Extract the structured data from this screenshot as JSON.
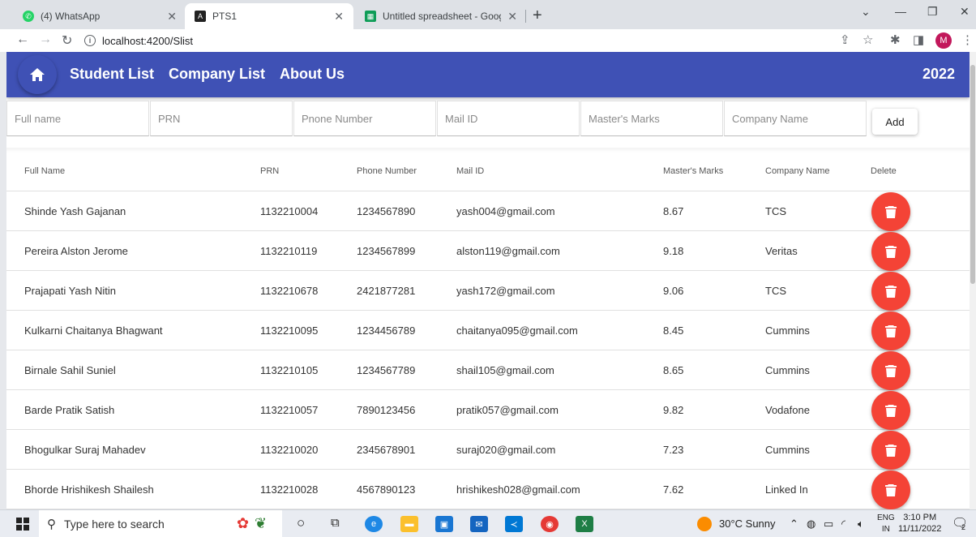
{
  "browser": {
    "tabs": [
      {
        "title": "(4) WhatsApp",
        "active": false
      },
      {
        "title": "PTS1",
        "active": true
      },
      {
        "title": "Untitled spreadsheet - Google Sh",
        "active": false
      }
    ],
    "url": "localhost:4200/Slist",
    "profile_initial": "M"
  },
  "app": {
    "nav": {
      "student_list": "Student List",
      "company_list": "Company List",
      "about_us": "About Us",
      "year": "2022"
    },
    "form": {
      "full_name_placeholder": "Full name",
      "prn_placeholder": "PRN",
      "phone_placeholder": "Pnone Number",
      "mail_placeholder": "Mail ID",
      "marks_placeholder": "Master's Marks",
      "company_placeholder": "Company Name",
      "add_label": "Add"
    },
    "table": {
      "headers": [
        "Full Name",
        "PRN",
        "Phone Number",
        "Mail ID",
        "Master's Marks",
        "Company Name",
        "Delete"
      ],
      "rows": [
        {
          "name": "Shinde Yash Gajanan",
          "prn": "1132210004",
          "phone": "1234567890",
          "mail": "yash004@gmail.com",
          "marks": "8.67",
          "company": "TCS"
        },
        {
          "name": "Pereira Alston Jerome",
          "prn": "1132210119",
          "phone": "1234567899",
          "mail": "alston119@gmail.com",
          "marks": "9.18",
          "company": "Veritas"
        },
        {
          "name": "Prajapati Yash Nitin",
          "prn": "1132210678",
          "phone": "2421877281",
          "mail": "yash172@gmail.com",
          "marks": "9.06",
          "company": "TCS"
        },
        {
          "name": "Kulkarni Chaitanya Bhagwant",
          "prn": "1132210095",
          "phone": "1234456789",
          "mail": "chaitanya095@gmail.com",
          "marks": "8.45",
          "company": "Cummins"
        },
        {
          "name": "Birnale Sahil Suniel",
          "prn": "1132210105",
          "phone": "1234567789",
          "mail": "shail105@gmail.com",
          "marks": "8.65",
          "company": "Cummins"
        },
        {
          "name": "Barde Pratik Satish",
          "prn": "1132210057",
          "phone": "7890123456",
          "mail": "pratik057@gmail.com",
          "marks": "9.82",
          "company": "Vodafone"
        },
        {
          "name": "Bhogulkar Suraj Mahadev",
          "prn": "1132210020",
          "phone": "2345678901",
          "mail": "suraj020@gmail.com",
          "marks": "7.23",
          "company": "Cummins"
        },
        {
          "name": "Bhorde Hrishikesh Shailesh",
          "prn": "1132210028",
          "phone": "4567890123",
          "mail": "hrishikesh028@gmail.com",
          "marks": "7.62",
          "company": "Linked In"
        }
      ]
    }
  },
  "taskbar": {
    "search_placeholder": "Type here to search",
    "weather": "30°C  Sunny",
    "lang": "ENG",
    "region": "IN",
    "time": "3:10 PM",
    "date": "11/11/2022",
    "notification_count": "2"
  },
  "colors": {
    "primary": "#3f51b5",
    "delete": "#f44336"
  }
}
